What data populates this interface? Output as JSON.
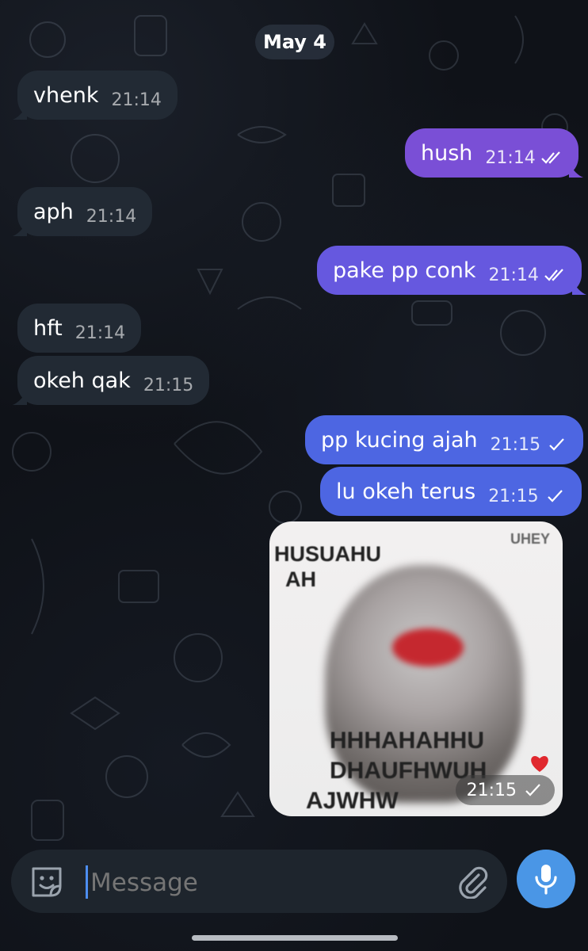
{
  "date_separator": "May 4",
  "messages": [
    {
      "text": "vhenk",
      "time": "21:14"
    },
    {
      "text": "hush",
      "time": "21:14"
    },
    {
      "text": "aph",
      "time": "21:14"
    },
    {
      "text": "pake pp conk",
      "time": "21:14"
    },
    {
      "text": "hft",
      "time": "21:14"
    },
    {
      "text": "okeh qak",
      "time": "21:15"
    },
    {
      "text": "pp kucing ajah",
      "time": "21:15"
    },
    {
      "text": "lu okeh terus",
      "time": "21:15"
    }
  ],
  "photo": {
    "time": "21:15",
    "meme_text": {
      "line1": "HUSUAHU",
      "line2": "AH",
      "corner": "UHEY",
      "bottom1": "HHHAHAHHU",
      "bottom2": "DHAUFHWUH",
      "bottom3": "AJWHW"
    }
  },
  "composer": {
    "placeholder": "Message"
  },
  "colors": {
    "background": "#0f1218",
    "incoming_bubble": "#222a34",
    "outgoing_purple": "#7a4fd6",
    "outgoing_violet": "#6658df",
    "outgoing_blue": "#4d66e2",
    "mic_button": "#4a96e6"
  },
  "icons": [
    "sticker-icon",
    "attach-icon",
    "mic-icon",
    "double-check-icon",
    "single-check-icon",
    "heart-icon"
  ]
}
